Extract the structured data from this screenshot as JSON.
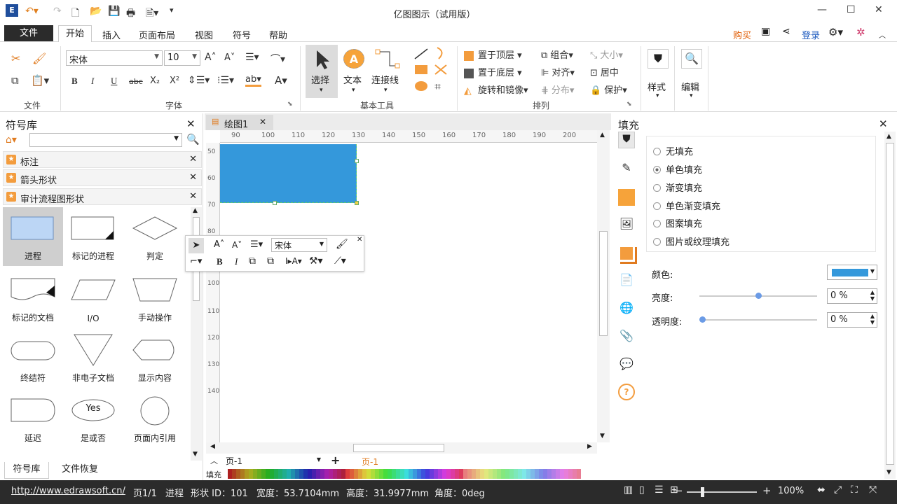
{
  "app": {
    "title": "亿图图示（试用版）"
  },
  "menu": {
    "file": "文件",
    "home": "开始",
    "insert": "插入",
    "layout": "页面布局",
    "view": "视图",
    "symbols": "符号",
    "help": "帮助",
    "buy": "购买",
    "buy_tooltip": "购买",
    "login": "登录"
  },
  "ribbon": {
    "file_group": "文件",
    "font_group": "字体",
    "font_name": "宋体",
    "font_size": "10",
    "tools_group": "基本工具",
    "select": "选择",
    "text": "文本",
    "connector": "连接线",
    "arrange_group": "排列",
    "bring_front": "置于顶层",
    "send_back": "置于底层",
    "rotate_mirror": "旋转和镜像",
    "group": "组合",
    "align": "对齐",
    "distribute": "分布",
    "size": "大小",
    "center": "居中",
    "protect": "保护",
    "style": "样式",
    "edit": "编辑"
  },
  "library": {
    "title": "符号库",
    "sections": [
      "标注",
      "箭头形状",
      "审计流程图形状"
    ],
    "shapes": [
      "进程",
      "标记的进程",
      "判定",
      "标记的文档",
      "I/O",
      "手动操作",
      "终结符",
      "非电子文档",
      "显示内容",
      "延迟",
      "是或否",
      "页面内引用"
    ],
    "yes_text": "Yes",
    "tabs": [
      "符号库",
      "文件恢复"
    ]
  },
  "canvas": {
    "doc_tab": "绘图1",
    "ruler_h": [
      "90",
      "100",
      "110",
      "120",
      "130",
      "140",
      "150",
      "160",
      "170",
      "180",
      "190",
      "200"
    ],
    "ruler_v": [
      "50",
      "60",
      "70",
      "80",
      "90",
      "100",
      "110",
      "120",
      "130",
      "140"
    ],
    "page_name": "页-1",
    "page_tab": "页-1",
    "fill_label": "填充",
    "float_font": "宋体",
    "shape_color": "#3498db"
  },
  "fill_panel": {
    "title": "填充",
    "options": [
      "无填充",
      "单色填充",
      "渐变填充",
      "单色渐变填充",
      "图案填充",
      "图片或纹理填充"
    ],
    "selected": "单色填充",
    "color_label": "颜色:",
    "brightness_label": "亮度:",
    "brightness_value": "0 %",
    "transparency_label": "透明度:",
    "transparency_value": "0 %"
  },
  "status": {
    "url": "http://www.edrawsoft.cn/",
    "page": "页1/1",
    "shape_name": "进程",
    "shape_id": "形状 ID：101",
    "width": "宽度：53.7104mm",
    "height": "高度：31.9977mm",
    "angle": "角度：0deg",
    "zoom": "100%"
  }
}
